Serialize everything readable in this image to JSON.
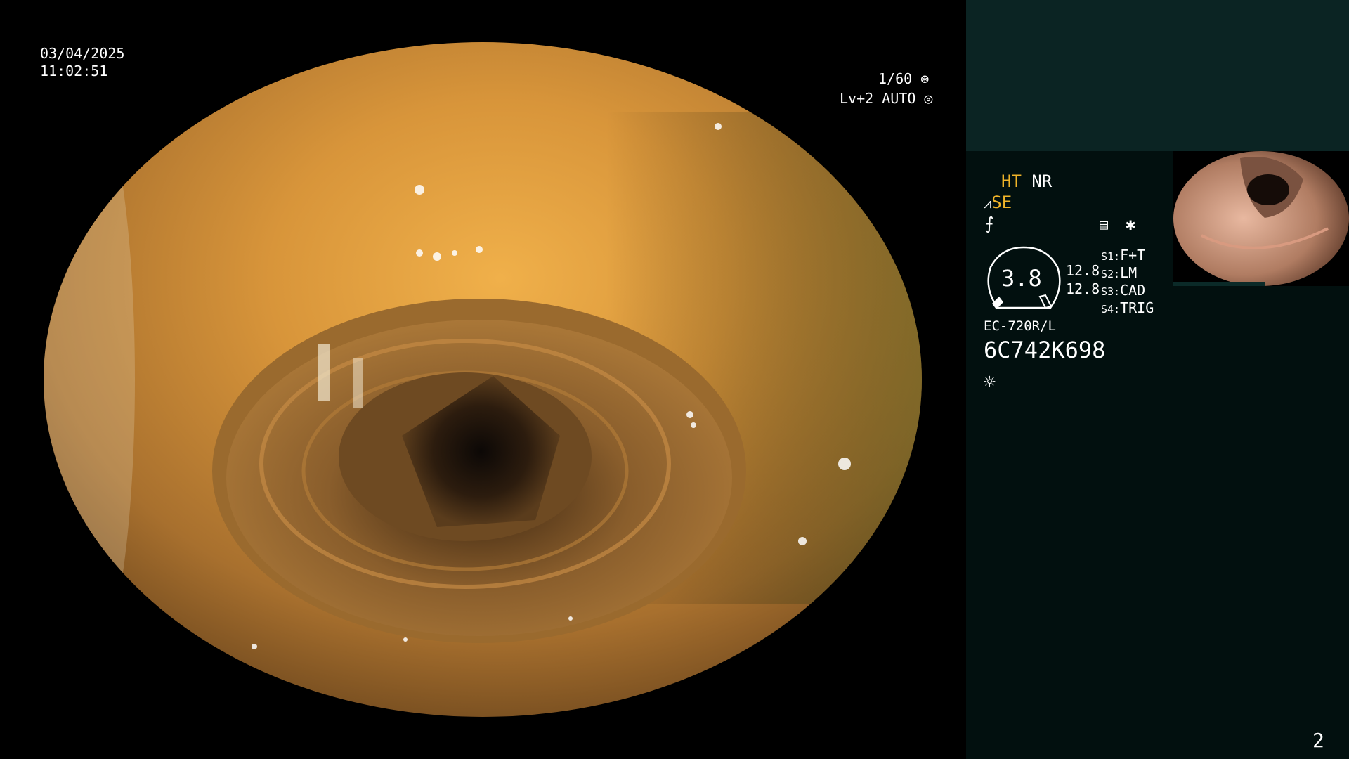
{
  "overlay": {
    "date": "03/04/2025",
    "time": "11:02:51",
    "shutter": "1/60",
    "level": "Lv+2 AUTO"
  },
  "panel": {
    "ht": "HT",
    "nr": "NR",
    "se": "SE",
    "gauge_value": "3.8",
    "val_a": "12.8",
    "val_b": "12.8",
    "s1_key": "S1:",
    "s1_val": "F+T",
    "s2_key": "S2:",
    "s2_val": "LM",
    "s3_key": "S3:",
    "s3_val": "CAD",
    "s4_key": "S4:",
    "s4_val": "TRIG",
    "scope_model": "EC-720R/L",
    "serial": "6C742K698",
    "page_number": "2"
  },
  "icons": {
    "shutter": "aperture-icon",
    "auto": "iris-icon",
    "structure": "structure-enhance-icon",
    "color": "color-mode-icon",
    "memo": "memo-icon",
    "asterisk": "asterisk-icon",
    "light": "light-sun-icon"
  },
  "colors": {
    "accent_yellow": "#f0b429",
    "panel_bg": "#02100f",
    "panel_top_bg": "#0b2423"
  }
}
